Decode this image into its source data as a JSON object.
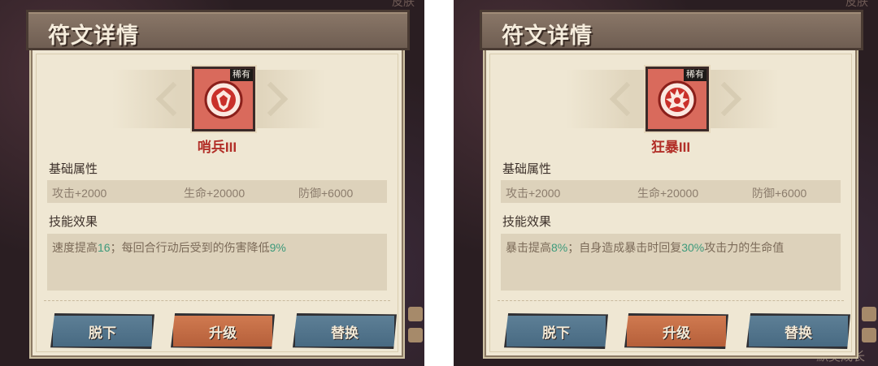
{
  "panels": [
    {
      "background": {
        "corner_text": "皮肤",
        "bottom_text": ""
      },
      "title": "符文详情",
      "rarity": "稀有",
      "rune_name": "哨兵III",
      "rune_color": "#d96a5c",
      "emblem_icon": "shield-emblem-icon",
      "base_label": "基础属性",
      "attributes": [
        "攻击+2000",
        "生命+20000",
        "防御+6000"
      ],
      "skill_label": "技能效果",
      "skill_segments": [
        {
          "text": "速度提高",
          "hl": false
        },
        {
          "text": "16",
          "hl": true
        },
        {
          "text": "；每回合行动后受到的伤害降低",
          "hl": false
        },
        {
          "text": "9%",
          "hl": true
        }
      ],
      "buttons": {
        "unequip": "脱下",
        "upgrade": "升级",
        "replace": "替换"
      }
    },
    {
      "background": {
        "corner_text": "皮肤",
        "bottom_text": "默契成长"
      },
      "title": "符文详情",
      "rarity": "稀有",
      "rune_name": "狂暴III",
      "rune_color": "#d96a5c",
      "emblem_icon": "flame-emblem-icon",
      "base_label": "基础属性",
      "attributes": [
        "攻击+2000",
        "生命+20000",
        "防御+6000"
      ],
      "skill_label": "技能效果",
      "skill_segments": [
        {
          "text": "暴击提高",
          "hl": false
        },
        {
          "text": "8%",
          "hl": true
        },
        {
          "text": "；自身造成暴击时回复",
          "hl": false
        },
        {
          "text": "30%",
          "hl": true
        },
        {
          "text": "攻击力的生命值",
          "hl": false
        }
      ],
      "buttons": {
        "unequip": "脱下",
        "upgrade": "升级",
        "replace": "替换"
      }
    }
  ],
  "colors": {
    "highlight": "#3d9a7b",
    "rune_name": "#b22f28",
    "panel_bg": "#efe7d3"
  }
}
